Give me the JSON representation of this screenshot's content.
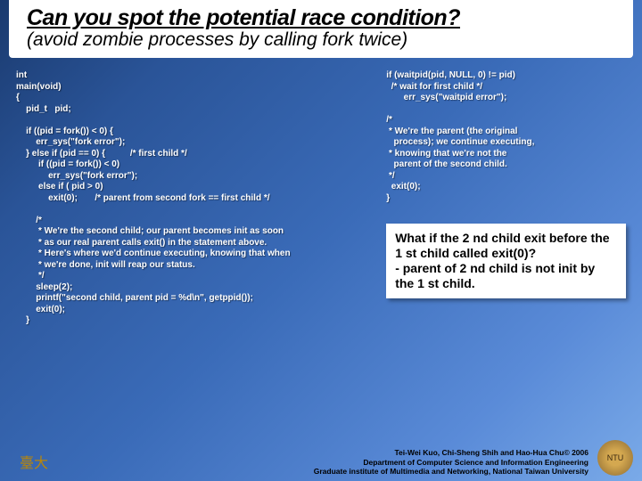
{
  "title": {
    "main": "Can you spot the potential race condition?",
    "sub": "(avoid zombie processes by calling fork twice)"
  },
  "code_left": "int\nmain(void)\n{\n    pid_t   pid;\n\n    if ((pid = fork()) < 0) {\n        err_sys(\"fork error\");\n    } else if (pid == 0) {          /* first child */\n         if ((pid = fork()) < 0)\n             err_sys(\"fork error\");\n         else if ( pid > 0)\n             exit(0);       /* parent from second fork == first child */\n\n        /*\n         * We're the second child; our parent becomes init as soon\n         * as our real parent calls exit() in the statement above.\n         * Here's where we'd continue executing, knowing that when\n         * we're done, init will reap our status.\n         */\n        sleep(2);\n        printf(\"second child, parent pid = %d\\n\", getppid());\n        exit(0);\n    }",
  "code_right": "if (waitpid(pid, NULL, 0) != pid)\n  /* wait for first child */\n       err_sys(\"waitpid error\");\n\n/*\n * We're the parent (the original\n   process); we continue executing,\n * knowing that we're not the\n   parent of the second child.\n */\n  exit(0);\n}",
  "question": "What if the 2 nd child exit before the 1 st child called exit(0)?\n- parent of 2 nd child is not init by the 1 st child.",
  "footer": {
    "line1": "Tei-Wei Kuo, Chi-Sheng Shih and Hao-Hua Chu© 2006",
    "line2": "Department of Computer Science and Information Engineering",
    "line3": "Graduate institute of Multimedia and Networking, National Taiwan University"
  },
  "logos": {
    "left": "臺大",
    "right": "NTU"
  }
}
